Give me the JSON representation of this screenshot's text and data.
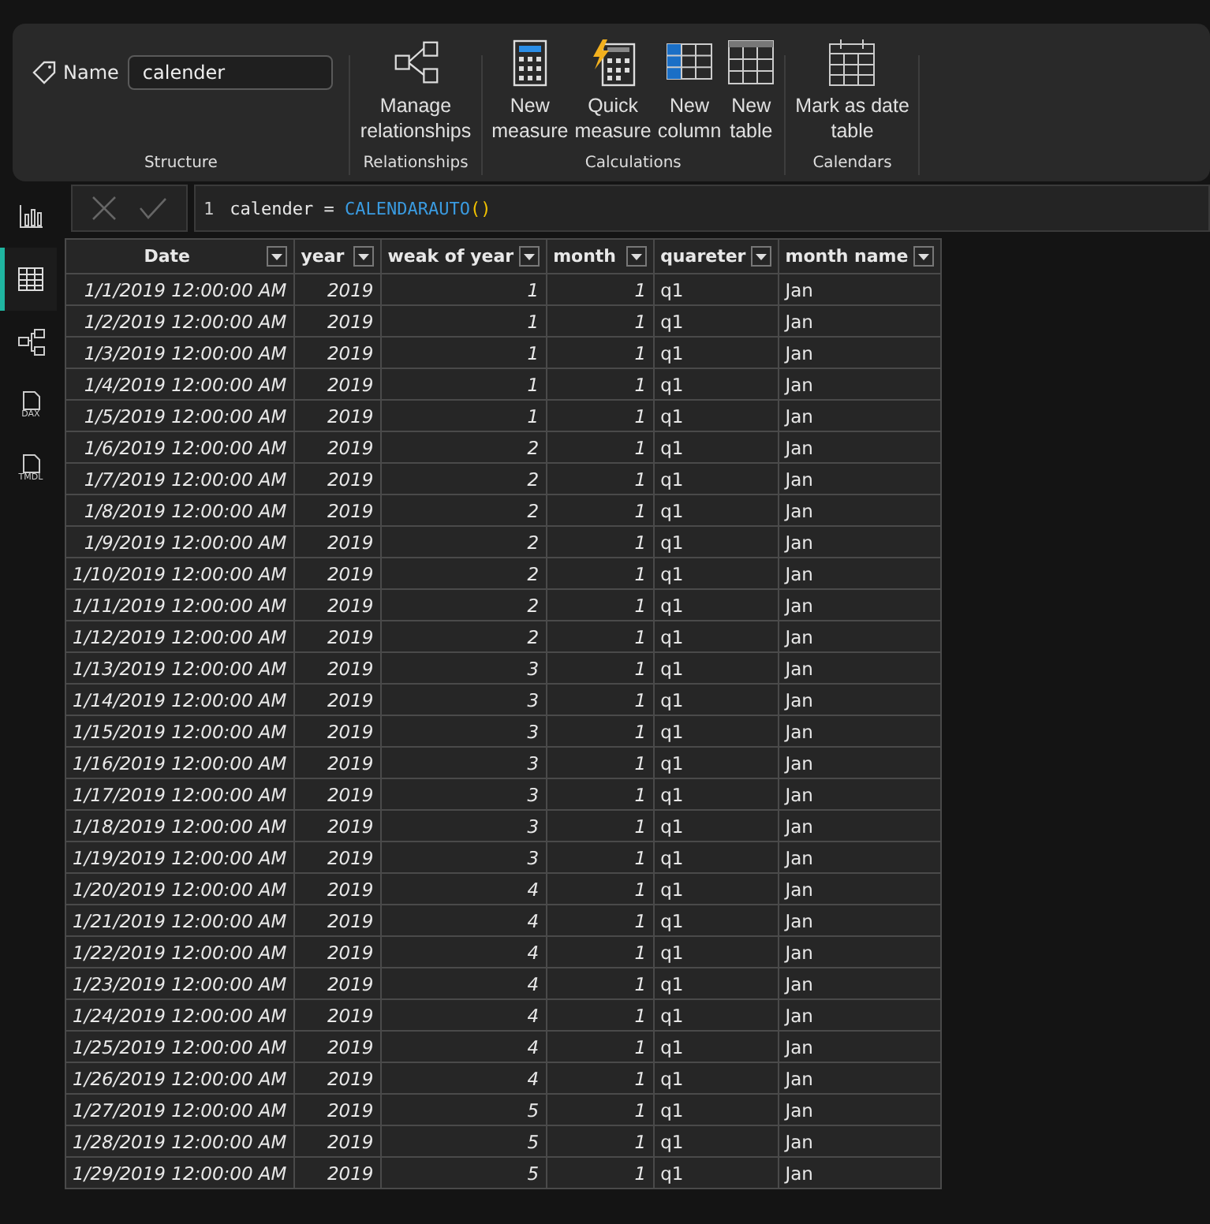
{
  "ribbon": {
    "groups": [
      {
        "kind": "name",
        "label": "Structure",
        "field_label": "Name",
        "field_value": "calender"
      },
      {
        "kind": "buttons",
        "label": "Relationships",
        "buttons": [
          {
            "kind": "relationships",
            "lines": [
              "Manage",
              "relationships"
            ]
          }
        ]
      },
      {
        "kind": "buttons",
        "label": "Calculations",
        "buttons": [
          {
            "kind": "measure",
            "lines": [
              "New",
              "measure"
            ]
          },
          {
            "kind": "quick",
            "lines": [
              "Quick",
              "measure"
            ]
          },
          {
            "kind": "column",
            "lines": [
              "New",
              "column"
            ]
          },
          {
            "kind": "table",
            "lines": [
              "New",
              "table"
            ]
          }
        ]
      },
      {
        "kind": "buttons",
        "label": "Calendars",
        "buttons": [
          {
            "kind": "calendar",
            "lines": [
              "Mark as date",
              "table"
            ]
          }
        ]
      }
    ]
  },
  "sidebar": {
    "items": [
      {
        "kind": "report",
        "selected": false
      },
      {
        "kind": "table",
        "selected": true
      },
      {
        "kind": "model",
        "selected": false
      },
      {
        "kind": "doc",
        "label": "DAX",
        "selected": false
      },
      {
        "kind": "doc",
        "label": "TMDL",
        "selected": false
      }
    ]
  },
  "formula_bar": {
    "line_number": "1",
    "tokens": [
      {
        "kind": "plain",
        "text": "calender = "
      },
      {
        "kind": "function",
        "text": "CALENDARAUTO"
      },
      {
        "kind": "paren",
        "text": "()"
      }
    ]
  },
  "table": {
    "columns": [
      {
        "name": "Date",
        "kind": "number"
      },
      {
        "name": "year",
        "kind": "number"
      },
      {
        "name": "weak of year",
        "kind": "number"
      },
      {
        "name": "month",
        "kind": "number"
      },
      {
        "name": "quareter",
        "kind": "text"
      },
      {
        "name": "month name",
        "kind": "text"
      }
    ],
    "rows": [
      [
        "1/1/2019 12:00:00 AM",
        "2019",
        "1",
        "1",
        "q1",
        "Jan"
      ],
      [
        "1/2/2019 12:00:00 AM",
        "2019",
        "1",
        "1",
        "q1",
        "Jan"
      ],
      [
        "1/3/2019 12:00:00 AM",
        "2019",
        "1",
        "1",
        "q1",
        "Jan"
      ],
      [
        "1/4/2019 12:00:00 AM",
        "2019",
        "1",
        "1",
        "q1",
        "Jan"
      ],
      [
        "1/5/2019 12:00:00 AM",
        "2019",
        "1",
        "1",
        "q1",
        "Jan"
      ],
      [
        "1/6/2019 12:00:00 AM",
        "2019",
        "2",
        "1",
        "q1",
        "Jan"
      ],
      [
        "1/7/2019 12:00:00 AM",
        "2019",
        "2",
        "1",
        "q1",
        "Jan"
      ],
      [
        "1/8/2019 12:00:00 AM",
        "2019",
        "2",
        "1",
        "q1",
        "Jan"
      ],
      [
        "1/9/2019 12:00:00 AM",
        "2019",
        "2",
        "1",
        "q1",
        "Jan"
      ],
      [
        "1/10/2019 12:00:00 AM",
        "2019",
        "2",
        "1",
        "q1",
        "Jan"
      ],
      [
        "1/11/2019 12:00:00 AM",
        "2019",
        "2",
        "1",
        "q1",
        "Jan"
      ],
      [
        "1/12/2019 12:00:00 AM",
        "2019",
        "2",
        "1",
        "q1",
        "Jan"
      ],
      [
        "1/13/2019 12:00:00 AM",
        "2019",
        "3",
        "1",
        "q1",
        "Jan"
      ],
      [
        "1/14/2019 12:00:00 AM",
        "2019",
        "3",
        "1",
        "q1",
        "Jan"
      ],
      [
        "1/15/2019 12:00:00 AM",
        "2019",
        "3",
        "1",
        "q1",
        "Jan"
      ],
      [
        "1/16/2019 12:00:00 AM",
        "2019",
        "3",
        "1",
        "q1",
        "Jan"
      ],
      [
        "1/17/2019 12:00:00 AM",
        "2019",
        "3",
        "1",
        "q1",
        "Jan"
      ],
      [
        "1/18/2019 12:00:00 AM",
        "2019",
        "3",
        "1",
        "q1",
        "Jan"
      ],
      [
        "1/19/2019 12:00:00 AM",
        "2019",
        "3",
        "1",
        "q1",
        "Jan"
      ],
      [
        "1/20/2019 12:00:00 AM",
        "2019",
        "4",
        "1",
        "q1",
        "Jan"
      ],
      [
        "1/21/2019 12:00:00 AM",
        "2019",
        "4",
        "1",
        "q1",
        "Jan"
      ],
      [
        "1/22/2019 12:00:00 AM",
        "2019",
        "4",
        "1",
        "q1",
        "Jan"
      ],
      [
        "1/23/2019 12:00:00 AM",
        "2019",
        "4",
        "1",
        "q1",
        "Jan"
      ],
      [
        "1/24/2019 12:00:00 AM",
        "2019",
        "4",
        "1",
        "q1",
        "Jan"
      ],
      [
        "1/25/2019 12:00:00 AM",
        "2019",
        "4",
        "1",
        "q1",
        "Jan"
      ],
      [
        "1/26/2019 12:00:00 AM",
        "2019",
        "4",
        "1",
        "q1",
        "Jan"
      ],
      [
        "1/27/2019 12:00:00 AM",
        "2019",
        "5",
        "1",
        "q1",
        "Jan"
      ],
      [
        "1/28/2019 12:00:00 AM",
        "2019",
        "5",
        "1",
        "q1",
        "Jan"
      ],
      [
        "1/29/2019 12:00:00 AM",
        "2019",
        "5",
        "1",
        "q1",
        "Jan"
      ]
    ]
  }
}
